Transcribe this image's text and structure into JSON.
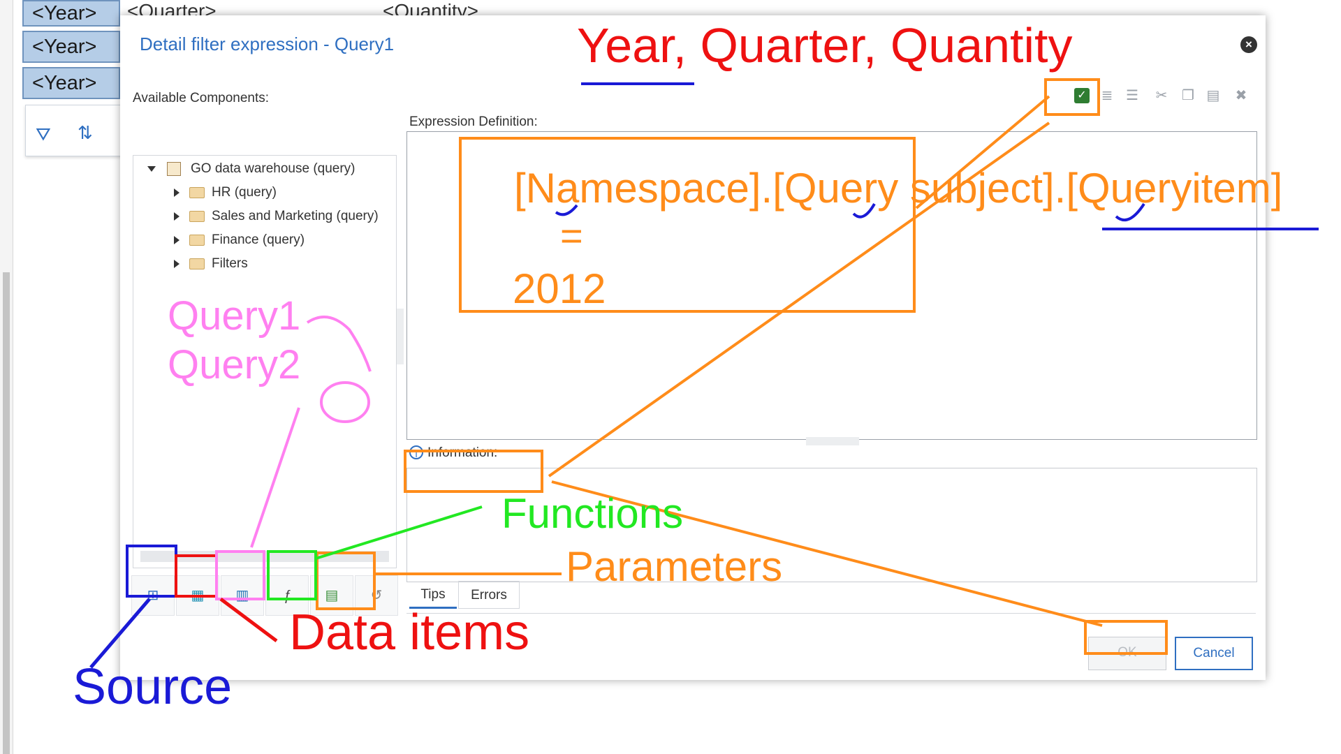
{
  "background": {
    "cells": [
      "<Year>",
      "<Year>",
      "<Year>"
    ],
    "headers": [
      "<Quarter>",
      "<Quantity>"
    ],
    "toolbar_icons": [
      "filter-icon",
      "sort-icon"
    ]
  },
  "dialog": {
    "title": "Detail filter expression - Query1",
    "available_components_label": "Available Components:",
    "expression_definition_label": "Expression Definition:",
    "information_label": "Information:",
    "tree": {
      "root": "GO data warehouse (query)",
      "children": [
        "HR (query)",
        "Sales and Marketing (query)",
        "Finance (query)",
        "Filters"
      ]
    },
    "bottom_tabs": [
      "Tips",
      "Errors"
    ],
    "toolbar_icons": [
      "validate-icon",
      "indent-icon",
      "outdent-icon",
      "cut-icon",
      "copy-icon",
      "paste-icon",
      "delete-icon"
    ],
    "tab_icons": [
      "source-tab-icon",
      "data-items-tab-icon",
      "query-tab-icon",
      "functions-tab-icon",
      "parameters-tab-icon",
      "history-tab-icon"
    ],
    "ok_label": "OK",
    "cancel_label": "Cancel"
  },
  "annotations": {
    "title_note": "Year, Quarter, Quantity",
    "expression_note_line1": "[Namespace].[Query subject].[Queryitem]",
    "expression_note_line2": "=",
    "expression_note_line3": "2012",
    "queries_line1": "Query1",
    "queries_line2": "Query2",
    "functions": "Functions",
    "parameters": "Parameters",
    "data_items": "Data items",
    "source": "Source"
  },
  "colors": {
    "orange": "#ff8c1a",
    "red": "#ee1111",
    "blue": "#1a1ad6",
    "green": "#22e822",
    "pink": "#ff80f0",
    "accent": "#2f6fc1"
  }
}
